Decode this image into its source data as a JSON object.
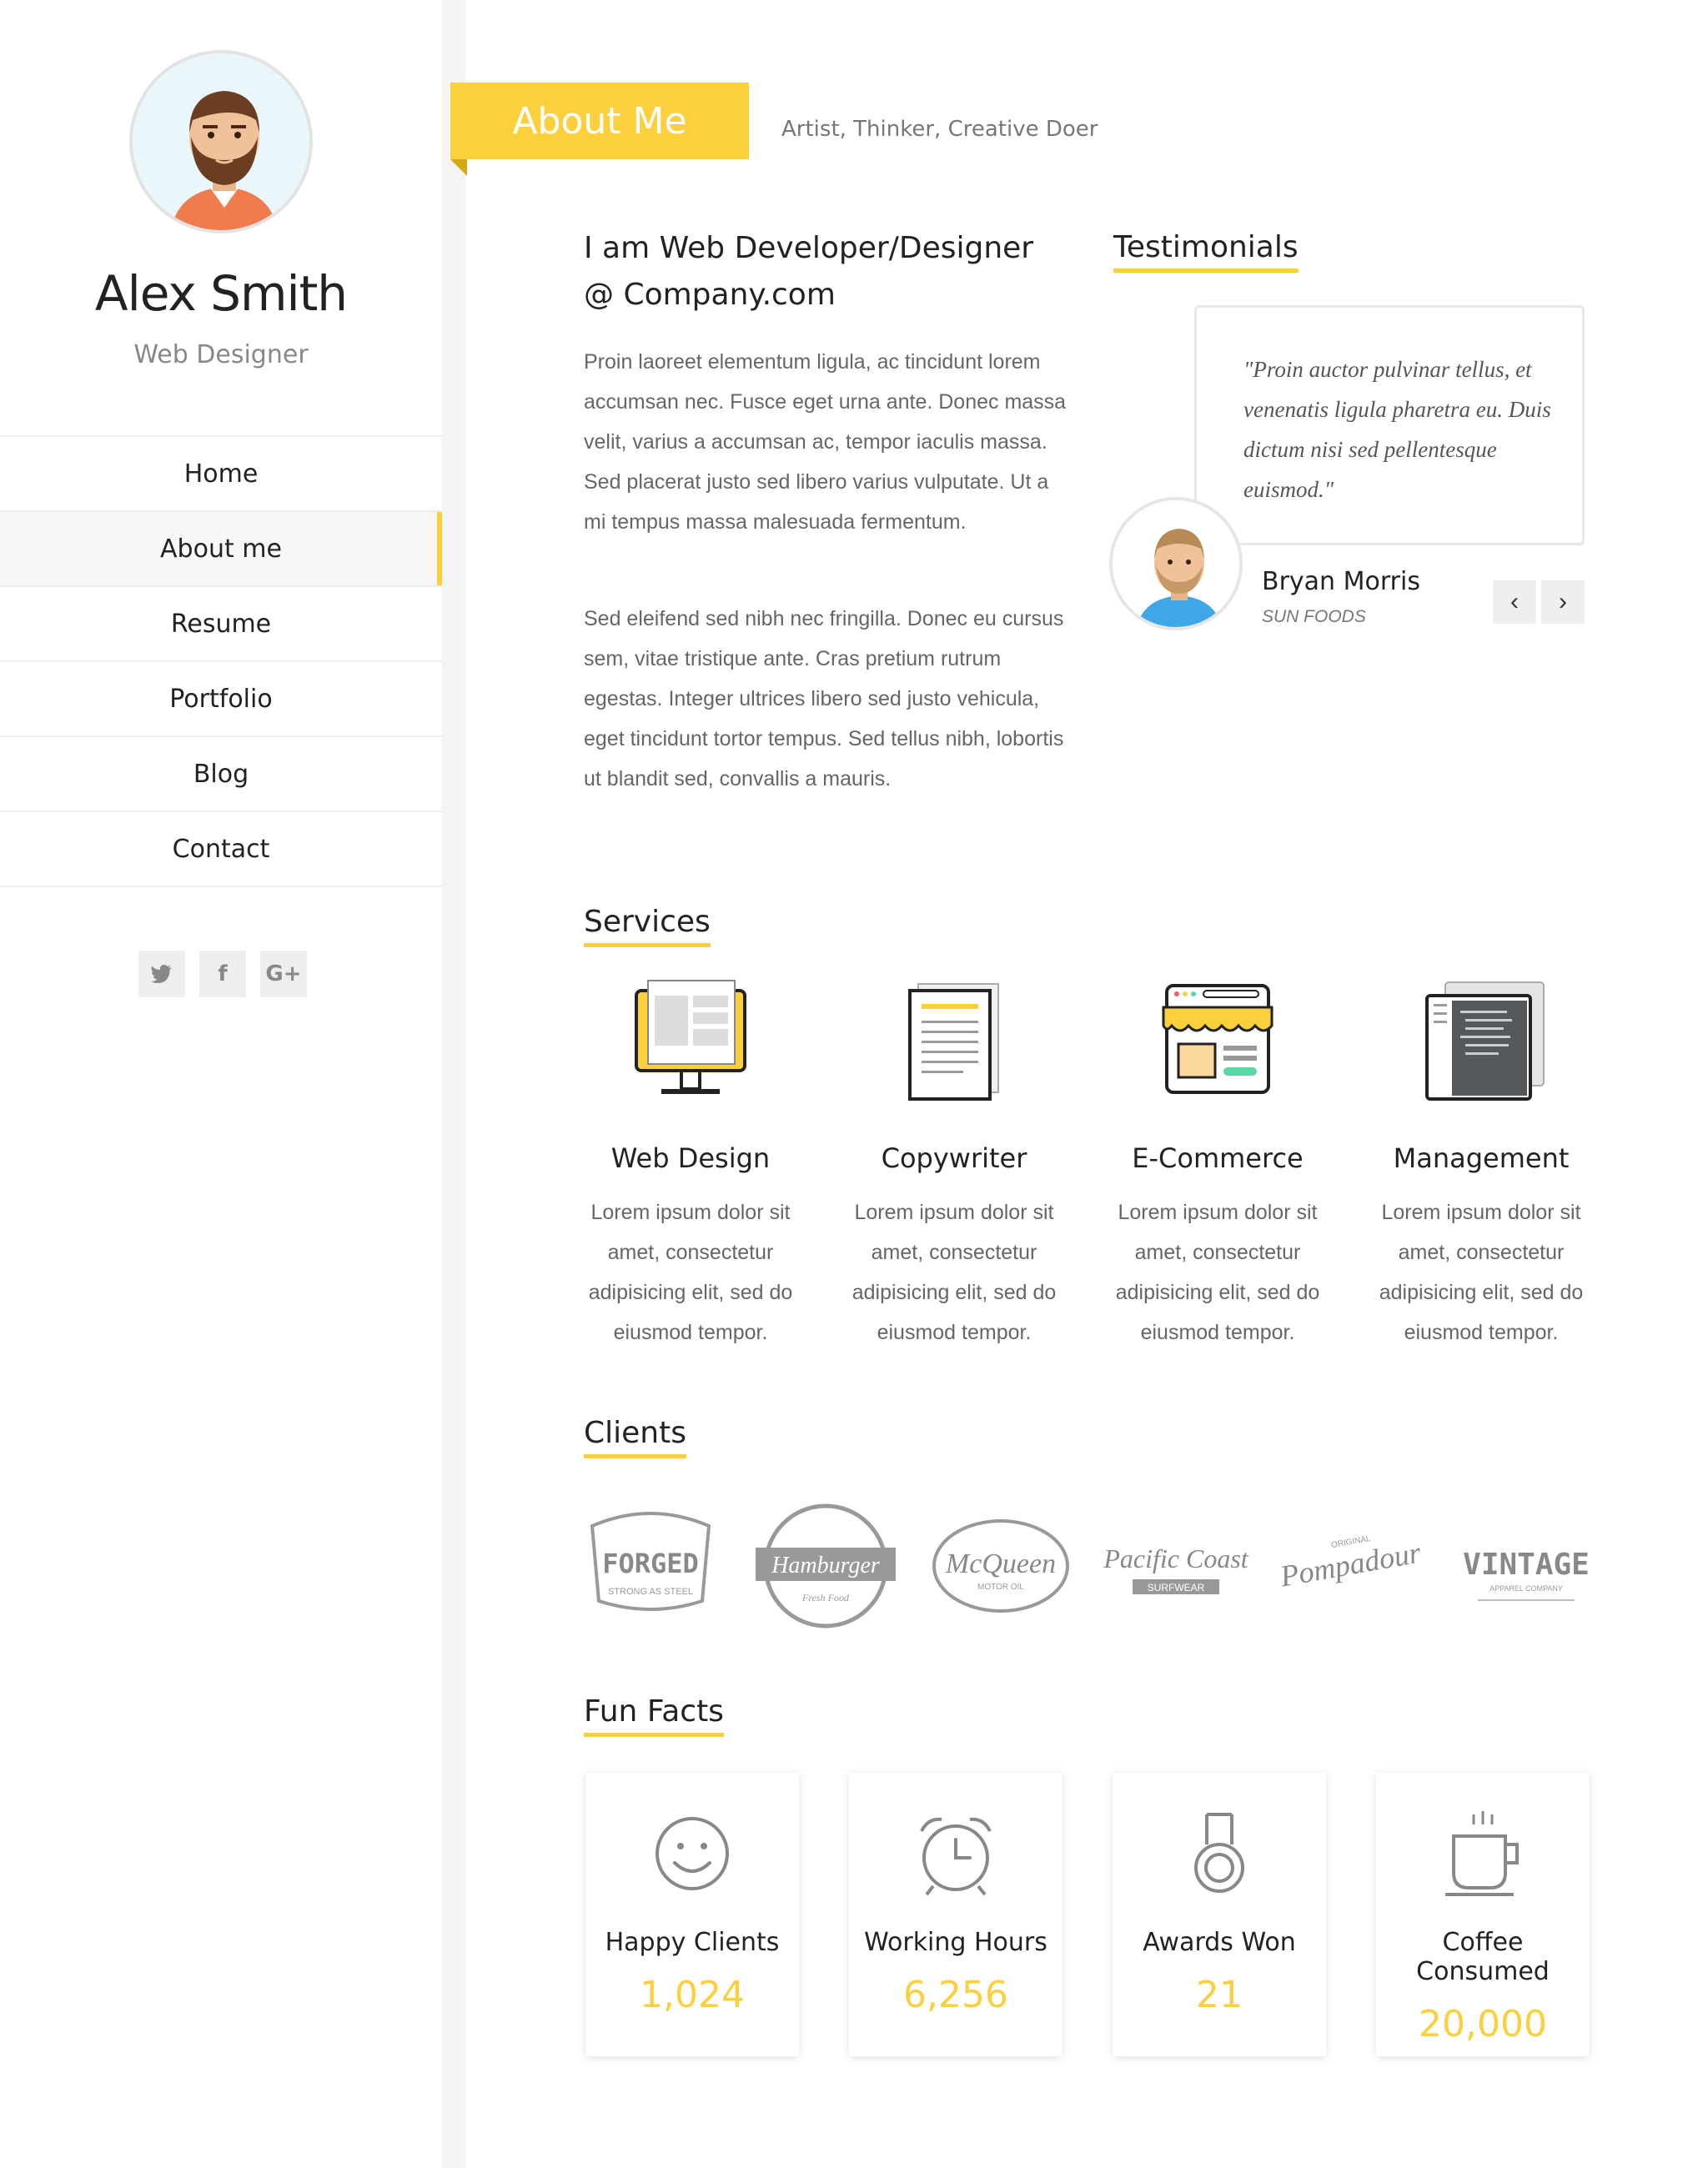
{
  "theme": {
    "accent": "#fcd03c"
  },
  "profile": {
    "name": "Alex Smith",
    "role": "Web Designer"
  },
  "nav": {
    "items": [
      {
        "label": "Home",
        "active": false
      },
      {
        "label": "About me",
        "active": true
      },
      {
        "label": "Resume",
        "active": false
      },
      {
        "label": "Portfolio",
        "active": false
      },
      {
        "label": "Blog",
        "active": false
      },
      {
        "label": "Contact",
        "active": false
      }
    ]
  },
  "social": [
    {
      "icon": "twitter-icon"
    },
    {
      "icon": "facebook-icon",
      "glyph": "f"
    },
    {
      "icon": "google-plus-icon",
      "glyph": "G+"
    }
  ],
  "header": {
    "title": "About Me",
    "subtitle": "Artist, Thinker, Creative Doer"
  },
  "about": {
    "heading": "I am Web Developer/Designer @ Company.com",
    "paragraphs": [
      "Proin laoreet elementum ligula, ac tincidunt lorem accumsan nec. Fusce eget urna ante. Donec massa velit, varius a accumsan ac, tempor iaculis massa. Sed placerat justo sed libero varius vulputate. Ut a mi tempus massa malesuada fermentum.",
      "Sed eleifend sed nibh nec fringilla. Donec eu cursus sem, vitae tristique ante. Cras pretium rutrum egestas. Integer ultrices libero sed justo vehicula, eget tincidunt tortor tempus. Sed tellus nibh, lobortis ut blandit sed, convallis a mauris."
    ]
  },
  "testimonials": {
    "heading": "Testimonials",
    "quote": "\"Proin auctor pulvinar tellus, et venenatis ligula pharetra eu. Duis dictum nisi sed pellentesque euismod.\"",
    "author": "Bryan Morris",
    "company": "SUN FOODS",
    "prev_glyph": "‹",
    "next_glyph": "›"
  },
  "services": {
    "heading": "Services",
    "items": [
      {
        "title": "Web Design",
        "desc": "Lorem ipsum dolor sit amet, consectetur adipisicing elit, sed do eiusmod tempor.",
        "icon": "monitor-icon"
      },
      {
        "title": "Copywriter",
        "desc": "Lorem ipsum dolor sit amet, consectetur adipisicing elit, sed do eiusmod tempor.",
        "icon": "document-icon"
      },
      {
        "title": "E-Commerce",
        "desc": "Lorem ipsum dolor sit amet, consectetur adipisicing elit, sed do eiusmod tempor.",
        "icon": "storefront-icon"
      },
      {
        "title": "Management",
        "desc": "Lorem ipsum dolor sit amet, consectetur adipisicing elit, sed do eiusmod tempor.",
        "icon": "code-window-icon"
      }
    ]
  },
  "clients": {
    "heading": "Clients",
    "logos": [
      {
        "text": "FORGED",
        "sub": "STRONG AS STEEL"
      },
      {
        "text": "Hamburger",
        "sub": "Fresh Food"
      },
      {
        "text": "McQueen",
        "sub": "MOTOR OIL"
      },
      {
        "text": "Pacific Coast",
        "sub": "SURFWEAR"
      },
      {
        "text": "Pompadour",
        "sub": "ORIGINAL"
      },
      {
        "text": "VINTAGE",
        "sub": "APPAREL COMPANY"
      }
    ]
  },
  "fun_facts": {
    "heading": "Fun Facts",
    "items": [
      {
        "label": "Happy Clients",
        "value": "1,024",
        "icon": "smiley-icon"
      },
      {
        "label": "Working Hours",
        "value": "6,256",
        "icon": "alarm-clock-icon"
      },
      {
        "label": "Awards Won",
        "value": "21",
        "icon": "medal-icon"
      },
      {
        "label": "Coffee Consumed",
        "value": "20,000",
        "icon": "coffee-cup-icon"
      }
    ]
  }
}
